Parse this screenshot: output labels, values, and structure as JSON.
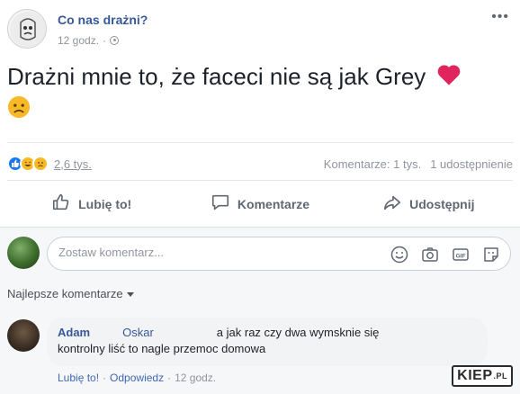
{
  "post": {
    "page_name": "Co nas drażni?",
    "time": "12 godz.",
    "text": "Drażni mnie to, że faceci nie są jak Grey"
  },
  "stats": {
    "reaction_count": "2,6 tys.",
    "comments": "Komentarze: 1 tys.",
    "shares": "1 udostępnienie"
  },
  "actions": {
    "like": "Lubię to!",
    "comment": "Komentarze",
    "share": "Udostępnij"
  },
  "comment_box": {
    "placeholder": "Zostaw komentarz..."
  },
  "sort_label": "Najlepsze komentarze",
  "comment": {
    "author": "Adam",
    "mention": "Oskar",
    "text_line1": "a jak raz czy dwa wymsknie się",
    "text_line2": "kontrolny liść to nagle przemoc domowa",
    "like": "Lubię to!",
    "reply": "Odpowiedz",
    "time": "12 godz."
  },
  "watermark": {
    "text": "KIEP",
    "suffix": ".PL"
  },
  "colors": {
    "link": "#365899",
    "heart": "#e0245e",
    "like_blue": "#1877f2"
  }
}
